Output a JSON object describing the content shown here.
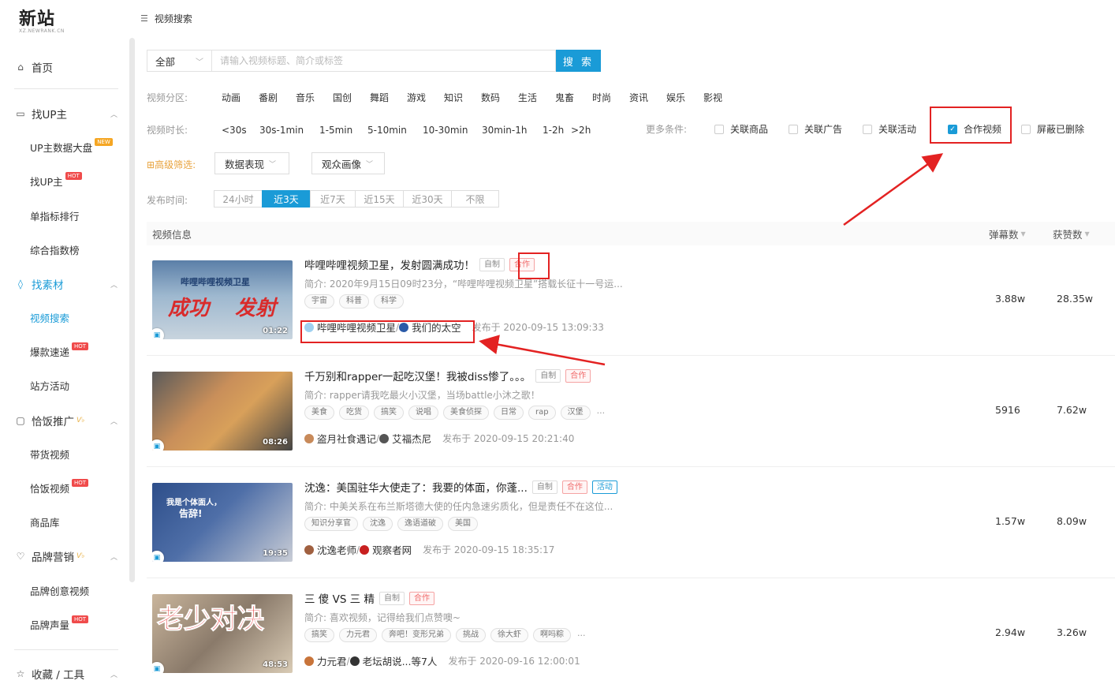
{
  "logo": {
    "main": "新站",
    "sub": "XZ.NEWRANK.CN"
  },
  "sidebar": {
    "home": "首页",
    "find_up": {
      "label": "找UP主",
      "items": [
        {
          "label": "UP主数据大盘",
          "badge": "NEW"
        },
        {
          "label": "找UP主",
          "badge": "HOT"
        },
        {
          "label": "单指标排行",
          "badge": ""
        },
        {
          "label": "综合指数榜",
          "badge": ""
        }
      ]
    },
    "find_material": {
      "label": "找素材",
      "items": [
        {
          "label": "视频搜索",
          "badge": ""
        },
        {
          "label": "爆款速递",
          "badge": "HOT"
        },
        {
          "label": "站方活动",
          "badge": ""
        }
      ]
    },
    "promo": {
      "label": "恰饭推广",
      "items": [
        {
          "label": "带货视频",
          "badge": ""
        },
        {
          "label": "恰饭视频",
          "badge": "HOT"
        },
        {
          "label": "商品库",
          "badge": ""
        }
      ]
    },
    "brand": {
      "label": "品牌营销",
      "items": [
        {
          "label": "品牌创意视频",
          "badge": ""
        },
        {
          "label": "品牌声量",
          "badge": "HOT"
        }
      ]
    },
    "fav": "收藏 / 工具"
  },
  "breadcrumb": "视频搜索",
  "search": {
    "scope": "全部",
    "placeholder": "请输入视频标题、简介或标签",
    "button": "搜 索"
  },
  "filters": {
    "zone_label": "视频分区:",
    "zones": [
      "动画",
      "番剧",
      "音乐",
      "国创",
      "舞蹈",
      "游戏",
      "知识",
      "数码",
      "生活",
      "鬼畜",
      "时尚",
      "资讯",
      "娱乐",
      "影视"
    ],
    "duration_label": "视频时长:",
    "durations": [
      "<30s",
      "30s-1min",
      "1-5min",
      "5-10min",
      "10-30min",
      "30min-1h",
      "1-2h",
      ">2h"
    ],
    "more_label": "更多条件:",
    "checks": [
      {
        "label": "关联商品",
        "checked": false
      },
      {
        "label": "关联广告",
        "checked": false
      },
      {
        "label": "关联活动",
        "checked": false
      },
      {
        "label": "合作视频",
        "checked": true
      },
      {
        "label": "屏蔽已删除",
        "checked": false
      }
    ],
    "advanced_label": "高级筛选:",
    "advanced": [
      "数据表现",
      "观众画像"
    ],
    "time_label": "发布时间:",
    "times": [
      "24小时",
      "近3天",
      "近7天",
      "近15天",
      "近30天",
      "不限"
    ],
    "time_active": "近3天"
  },
  "table": {
    "header_info": "视频信息",
    "header_danmaku": "弹幕数",
    "header_likes": "获赞数",
    "rows": [
      {
        "title": "哔哩哔哩视频卫星，发射圆满成功！",
        "tags": [
          "自制",
          "合作"
        ],
        "desc": "简介: 2020年9月15日09时23分，“哔哩哔哩视频卫星”搭载长征十一号运...",
        "keywords": [
          "宇宙",
          "科普",
          "科学"
        ],
        "has_more": false,
        "authors": [
          "哔哩哔哩视频卫星",
          "我们的太空"
        ],
        "published": "发布于 2020-09-15 13:09:33",
        "duration": "01:22",
        "thumb_text": [
          "哔哩哔哩视频卫星",
          "成功",
          "发射"
        ],
        "danmaku": "3.88w",
        "likes": "28.35w"
      },
      {
        "title": "千万别和rapper一起吃汉堡！我被diss惨了。。。",
        "tags": [
          "自制",
          "合作"
        ],
        "desc": "简介: rapper请我吃最火小汉堡，当场battle小沐之歌！",
        "keywords": [
          "美食",
          "吃货",
          "搞笑",
          "说唱",
          "美食侦探",
          "日常",
          "rap",
          "汉堡"
        ],
        "has_more": true,
        "authors": [
          "盗月社食遇记",
          "艾福杰尼"
        ],
        "published": "发布于 2020-09-15 20:21:40",
        "duration": "08:26",
        "thumb_text": [],
        "danmaku": "5916",
        "likes": "7.62w"
      },
      {
        "title": "沈逸：美国驻华大使走了：我要的体面，你蓬...",
        "tags": [
          "自制",
          "合作",
          "活动"
        ],
        "desc": "简介: 中美关系在布兰斯塔德大使的任内急速劣质化，但是责任不在这位...",
        "keywords": [
          "知识分享官",
          "沈逸",
          "逸语道破",
          "美国"
        ],
        "has_more": false,
        "authors": [
          "沈逸老师",
          "观察者网"
        ],
        "published": "发布于 2020-09-15 18:35:17",
        "duration": "19:35",
        "thumb_text": [
          "我是个体面人，",
          "告辞!"
        ],
        "danmaku": "1.57w",
        "likes": "8.09w"
      },
      {
        "title": "三 傻 VS 三 精",
        "tags": [
          "自制",
          "合作"
        ],
        "desc": "简介: 喜欢视频，记得给我们点赞噢~",
        "keywords": [
          "搞笑",
          "力元君",
          "奔吧！变形兄弟",
          "挑战",
          "徐大虾",
          "啊吗粽"
        ],
        "has_more": true,
        "authors": [
          "力元君",
          "老坛胡说...等7人"
        ],
        "published": "发布于 2020-09-16 12:00:01",
        "duration": "48:53",
        "thumb_text": [
          "老少对决"
        ],
        "danmaku": "2.94w",
        "likes": "3.26w"
      }
    ]
  },
  "colors": {
    "accent": "#1a9bd7",
    "annotation": "#e32222",
    "coop_tag": "#f06b6b"
  }
}
